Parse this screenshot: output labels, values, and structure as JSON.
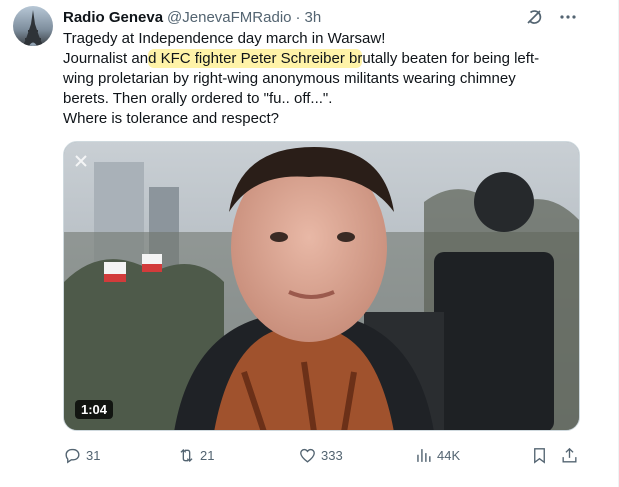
{
  "author": {
    "name": "Radio Geneva",
    "handle": "@JenevaFMRadio",
    "separator": "·",
    "time": "3h"
  },
  "text": {
    "line1": "Tragedy at Independence day march in Warsaw!",
    "line2_pre": "Journalist an",
    "line2_highlight": "d KFC fighter Peter Schreiber br",
    "line2_post": "utally beaten for being left-",
    "line3": "wing proletarian by right-wing anonymous militants wearing chimney",
    "line4": "berets. Then orally ordered to \"fu.. off...\".",
    "line5": "Where is tolerance and respect?"
  },
  "media": {
    "duration": "1:04"
  },
  "actions": {
    "replies": "31",
    "reposts": "21",
    "likes": "333",
    "views": "44K"
  },
  "icons": {
    "grok": "grok-icon",
    "more": "more-icon",
    "reply": "reply-icon",
    "repost": "repost-icon",
    "like": "like-icon",
    "views": "views-icon",
    "bookmark": "bookmark-icon",
    "share": "share-icon"
  },
  "colors": {
    "highlight": "#fff3a8",
    "secondary_text": "#536471",
    "primary_text": "#0f1419"
  }
}
